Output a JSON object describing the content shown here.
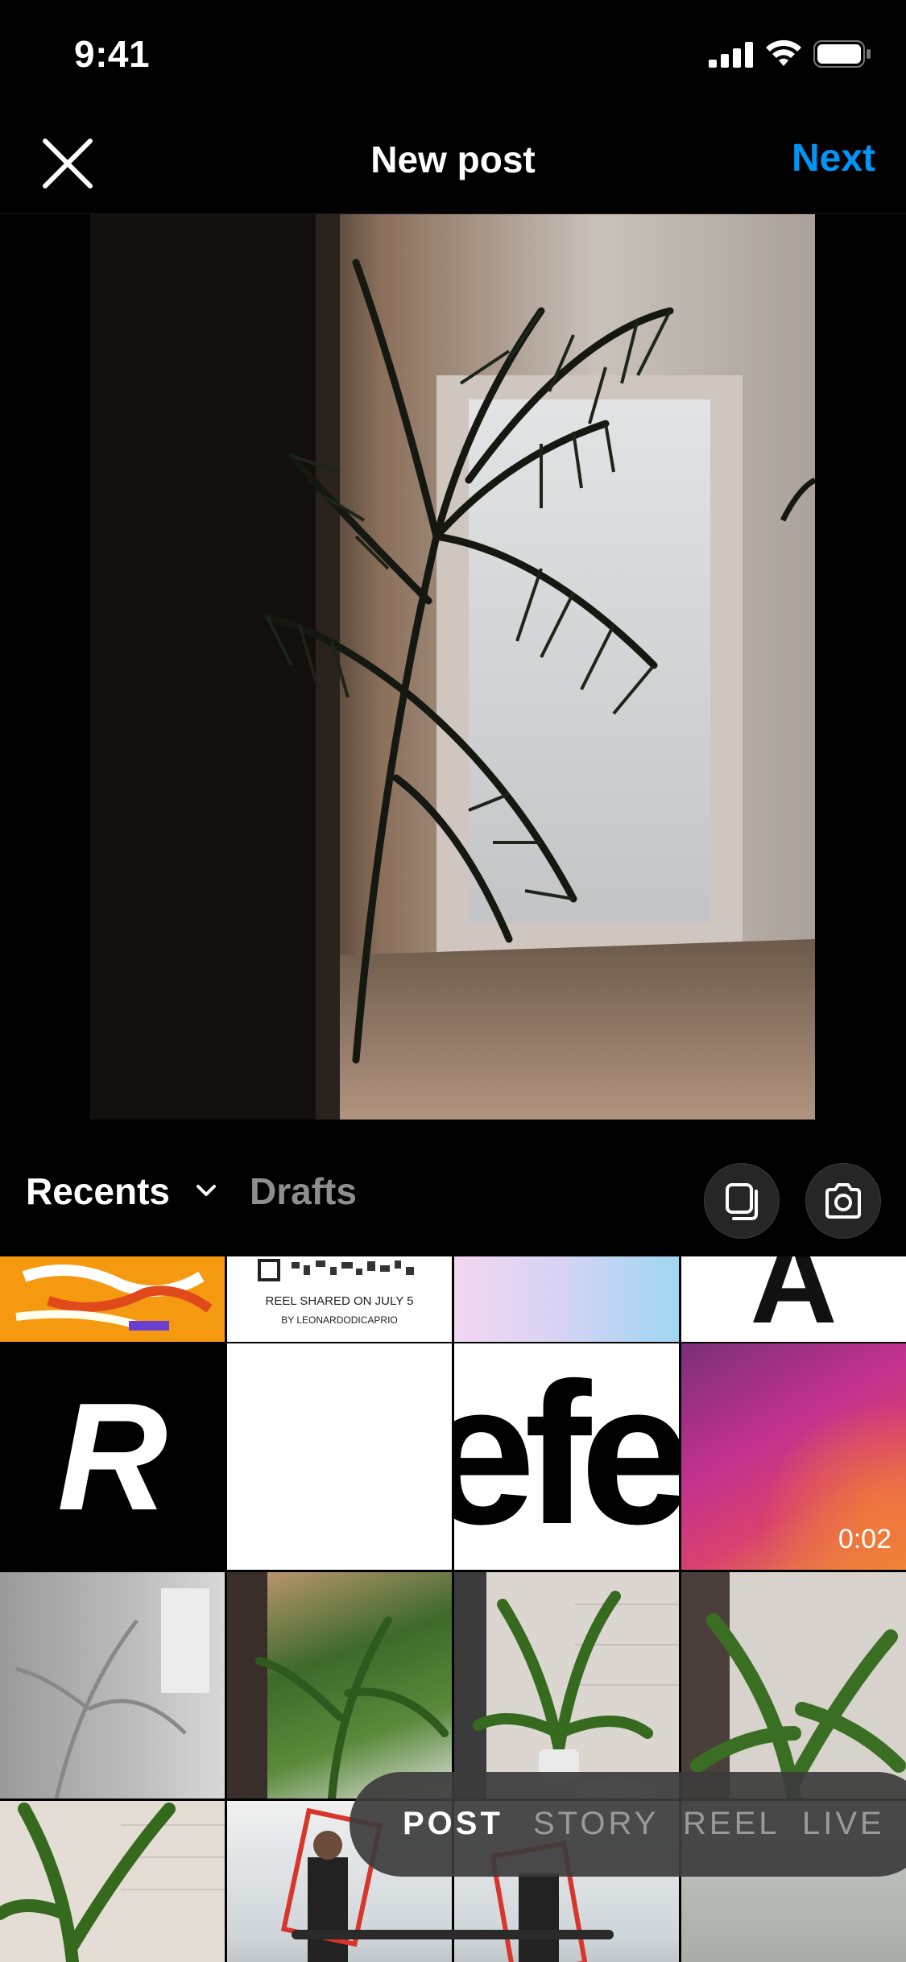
{
  "status_bar": {
    "time": "9:41"
  },
  "header": {
    "title": "New post",
    "next_label": "Next"
  },
  "icons": {
    "close": "close-icon",
    "expand": "expand-icon",
    "chevron": "chevron-down-icon",
    "multi_select": "multi-select-icon",
    "camera": "camera-icon"
  },
  "gallery_toolbar": {
    "recents_label": "Recents",
    "drafts_label": "Drafts"
  },
  "grid": {
    "tiles": [
      {
        "kind": "orange-sketch"
      },
      {
        "kind": "reel-card",
        "text": "REEL SHARED ON JULY 5",
        "subtext": "BY LEONARDODICAPRIO"
      },
      {
        "kind": "gradient"
      },
      {
        "kind": "letter-top",
        "letter": "A"
      },
      {
        "kind": "letter",
        "letter": "R"
      },
      {
        "kind": "blank"
      },
      {
        "kind": "word",
        "word": "efe"
      },
      {
        "kind": "video",
        "duration": "0:02"
      }
    ]
  },
  "modes": [
    "POST",
    "STORY",
    "REEL",
    "LIVE"
  ],
  "active_mode": "POST",
  "colors": {
    "accent": "#0095f6",
    "background": "#000000",
    "inactive": "#8e8e8e"
  }
}
